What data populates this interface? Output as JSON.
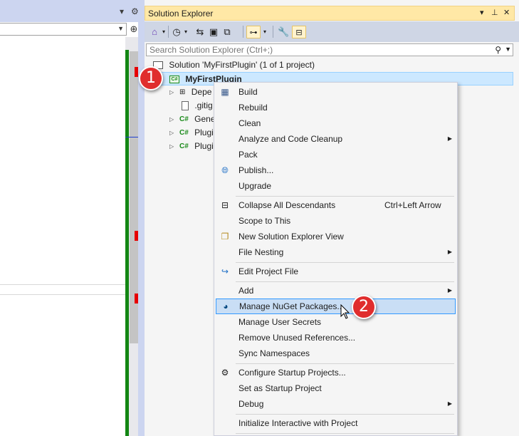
{
  "left_pane": {
    "split_glyph": "⊕",
    "pin_glyph": "▾",
    "gear_glyph": "⚙"
  },
  "solution_explorer": {
    "title": "Solution Explorer",
    "title_buttons": {
      "dropdown": "▾",
      "pin": "⊥",
      "close": "✕"
    },
    "search": {
      "placeholder": "Search Solution Explorer (Ctrl+;)"
    },
    "tree": {
      "solution": "Solution 'MyFirstPlugin' (1 of 1 project)",
      "project": "MyFirstPlugin",
      "children": [
        {
          "label": "Depe",
          "icon": "dependencies-icon",
          "expandable": true
        },
        {
          "label": ".gitig",
          "icon": "file-icon",
          "expandable": false
        },
        {
          "label": "Gene",
          "icon": "csharp-file-icon",
          "expandable": true
        },
        {
          "label": "Plugi",
          "icon": "csharp-file-icon",
          "expandable": true
        },
        {
          "label": "Plugi",
          "icon": "csharp-file-icon",
          "expandable": true
        }
      ]
    }
  },
  "context_menu": {
    "items": [
      {
        "label": "Build",
        "icon": "build-icon",
        "group": 0
      },
      {
        "label": "Rebuild",
        "group": 0
      },
      {
        "label": "Clean",
        "group": 0
      },
      {
        "label": "Analyze and Code Cleanup",
        "submenu": true,
        "group": 0
      },
      {
        "label": "Pack",
        "group": 0
      },
      {
        "label": "Publish...",
        "icon": "globe-icon",
        "group": 0
      },
      {
        "label": "Upgrade",
        "group": 0
      },
      {
        "label": "Collapse All Descendants",
        "shortcut": "Ctrl+Left Arrow",
        "icon": "collapse-icon",
        "group": 1
      },
      {
        "label": "Scope to This",
        "group": 1
      },
      {
        "label": "New Solution Explorer View",
        "icon": "new-view-icon",
        "group": 1
      },
      {
        "label": "File Nesting",
        "submenu": true,
        "group": 1
      },
      {
        "label": "Edit Project File",
        "icon": "edit-project-icon",
        "group": 2
      },
      {
        "label": "Add",
        "submenu": true,
        "group": 3
      },
      {
        "label": "Manage NuGet Packages...",
        "icon": "nuget-icon",
        "highlighted": true,
        "group": 3
      },
      {
        "label": "Manage User Secrets",
        "group": 3
      },
      {
        "label": "Remove Unused References...",
        "group": 3
      },
      {
        "label": "Sync Namespaces",
        "group": 3
      },
      {
        "label": "Configure Startup Projects...",
        "icon": "gear-icon",
        "group": 4
      },
      {
        "label": "Set as Startup Project",
        "group": 4
      },
      {
        "label": "Debug",
        "submenu": true,
        "group": 4
      },
      {
        "label": "Initialize Interactive with Project",
        "group": 5
      }
    ]
  },
  "callouts": {
    "step1": "1",
    "step2": "2"
  },
  "colors": {
    "title_bar": "#ffe8a6",
    "toolbar": "#cfd6e5",
    "selection": "#cce8ff",
    "menu_highlight": "#c9def5",
    "callout": "#e02d2d",
    "frame": "#ccd5f0"
  }
}
